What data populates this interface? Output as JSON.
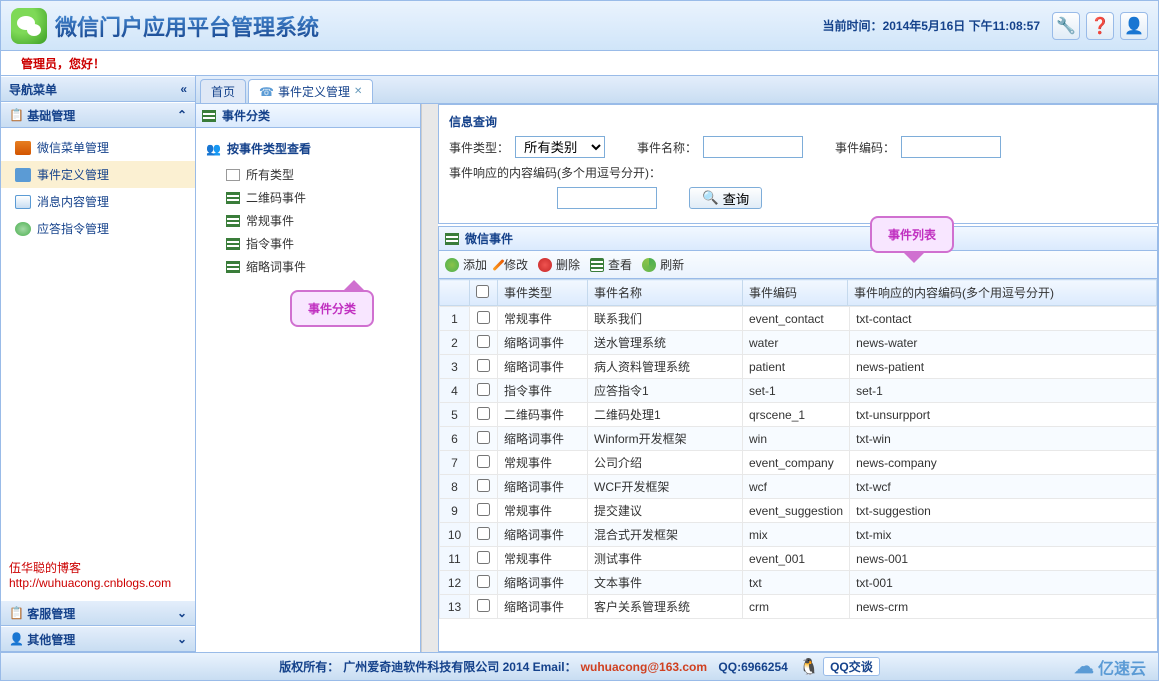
{
  "header": {
    "title": "微信门户应用平台管理系统",
    "time_label": "当前时间：",
    "time_value": "2014年5月16日 下午11:08:57"
  },
  "greeting": "管理员，您好！",
  "nav": {
    "title": "导航菜单",
    "panels": [
      {
        "title": "基础管理",
        "expanded": true
      },
      {
        "title": "客服管理",
        "expanded": false
      },
      {
        "title": "其他管理",
        "expanded": false
      }
    ],
    "items": [
      {
        "label": "微信菜单管理",
        "icon": "menu"
      },
      {
        "label": "事件定义管理",
        "icon": "event",
        "active": true
      },
      {
        "label": "消息内容管理",
        "icon": "msg"
      },
      {
        "label": "应答指令管理",
        "icon": "cmd"
      }
    ]
  },
  "blog": {
    "text": "伍华聪的博客 ",
    "url": "http://wuhuacong.cnblogs.com"
  },
  "tabs": [
    {
      "label": "首页",
      "active": false
    },
    {
      "label": "事件定义管理",
      "active": true,
      "closable": true
    }
  ],
  "tree": {
    "title": "事件分类",
    "group": "按事件类型查看",
    "items": [
      {
        "label": "所有类型",
        "icon": "all"
      },
      {
        "label": "二维码事件",
        "icon": "grid"
      },
      {
        "label": "常规事件",
        "icon": "grid"
      },
      {
        "label": "指令事件",
        "icon": "grid"
      },
      {
        "label": "缩略词事件",
        "icon": "grid"
      }
    ]
  },
  "query": {
    "title": "信息查询",
    "type_label": "事件类型：",
    "type_value": "所有类别",
    "name_label": "事件名称：",
    "code_label": "事件编码：",
    "resp_label": "事件响应的内容编码(多个用逗号分开)：",
    "button": "查询"
  },
  "grid": {
    "title": "微信事件",
    "toolbar": {
      "add": "添加",
      "edit": "修改",
      "del": "删除",
      "view": "查看",
      "refresh": "刷新"
    },
    "columns": [
      "",
      "",
      "事件类型",
      "事件名称",
      "事件编码",
      "事件响应的内容编码(多个用逗号分开)"
    ],
    "rows": [
      [
        "1",
        "常规事件",
        "联系我们",
        "event_contact",
        "txt-contact"
      ],
      [
        "2",
        "缩略词事件",
        "送水管理系统",
        "water",
        "news-water"
      ],
      [
        "3",
        "缩略词事件",
        "病人资料管理系统",
        "patient",
        "news-patient"
      ],
      [
        "4",
        "指令事件",
        "应答指令1",
        "set-1",
        "set-1"
      ],
      [
        "5",
        "二维码事件",
        "二维码处理1",
        "qrscene_1",
        "txt-unsurpport"
      ],
      [
        "6",
        "缩略词事件",
        "Winform开发框架",
        "win",
        "txt-win"
      ],
      [
        "7",
        "常规事件",
        "公司介绍",
        "event_company",
        "news-company"
      ],
      [
        "8",
        "缩略词事件",
        "WCF开发框架",
        "wcf",
        "txt-wcf"
      ],
      [
        "9",
        "常规事件",
        "提交建议",
        "event_suggestion",
        "txt-suggestion"
      ],
      [
        "10",
        "缩略词事件",
        "混合式开发框架",
        "mix",
        "txt-mix"
      ],
      [
        "11",
        "常规事件",
        "测试事件",
        "event_001",
        "news-001"
      ],
      [
        "12",
        "缩略词事件",
        "文本事件",
        "txt",
        "txt-001"
      ],
      [
        "13",
        "缩略词事件",
        "客户关系管理系统",
        "crm",
        "news-crm"
      ]
    ]
  },
  "callouts": {
    "left": "事件分类",
    "right": "事件列表"
  },
  "footer": {
    "copyright": "版权所有：",
    "company": "广州爱奇迪软件科技有限公司 2014 Email：",
    "email": "wuhuacong@163.com",
    "qq_label": "QQ:6966254",
    "qq_btn": "QQ交谈",
    "brand": "亿速云"
  }
}
